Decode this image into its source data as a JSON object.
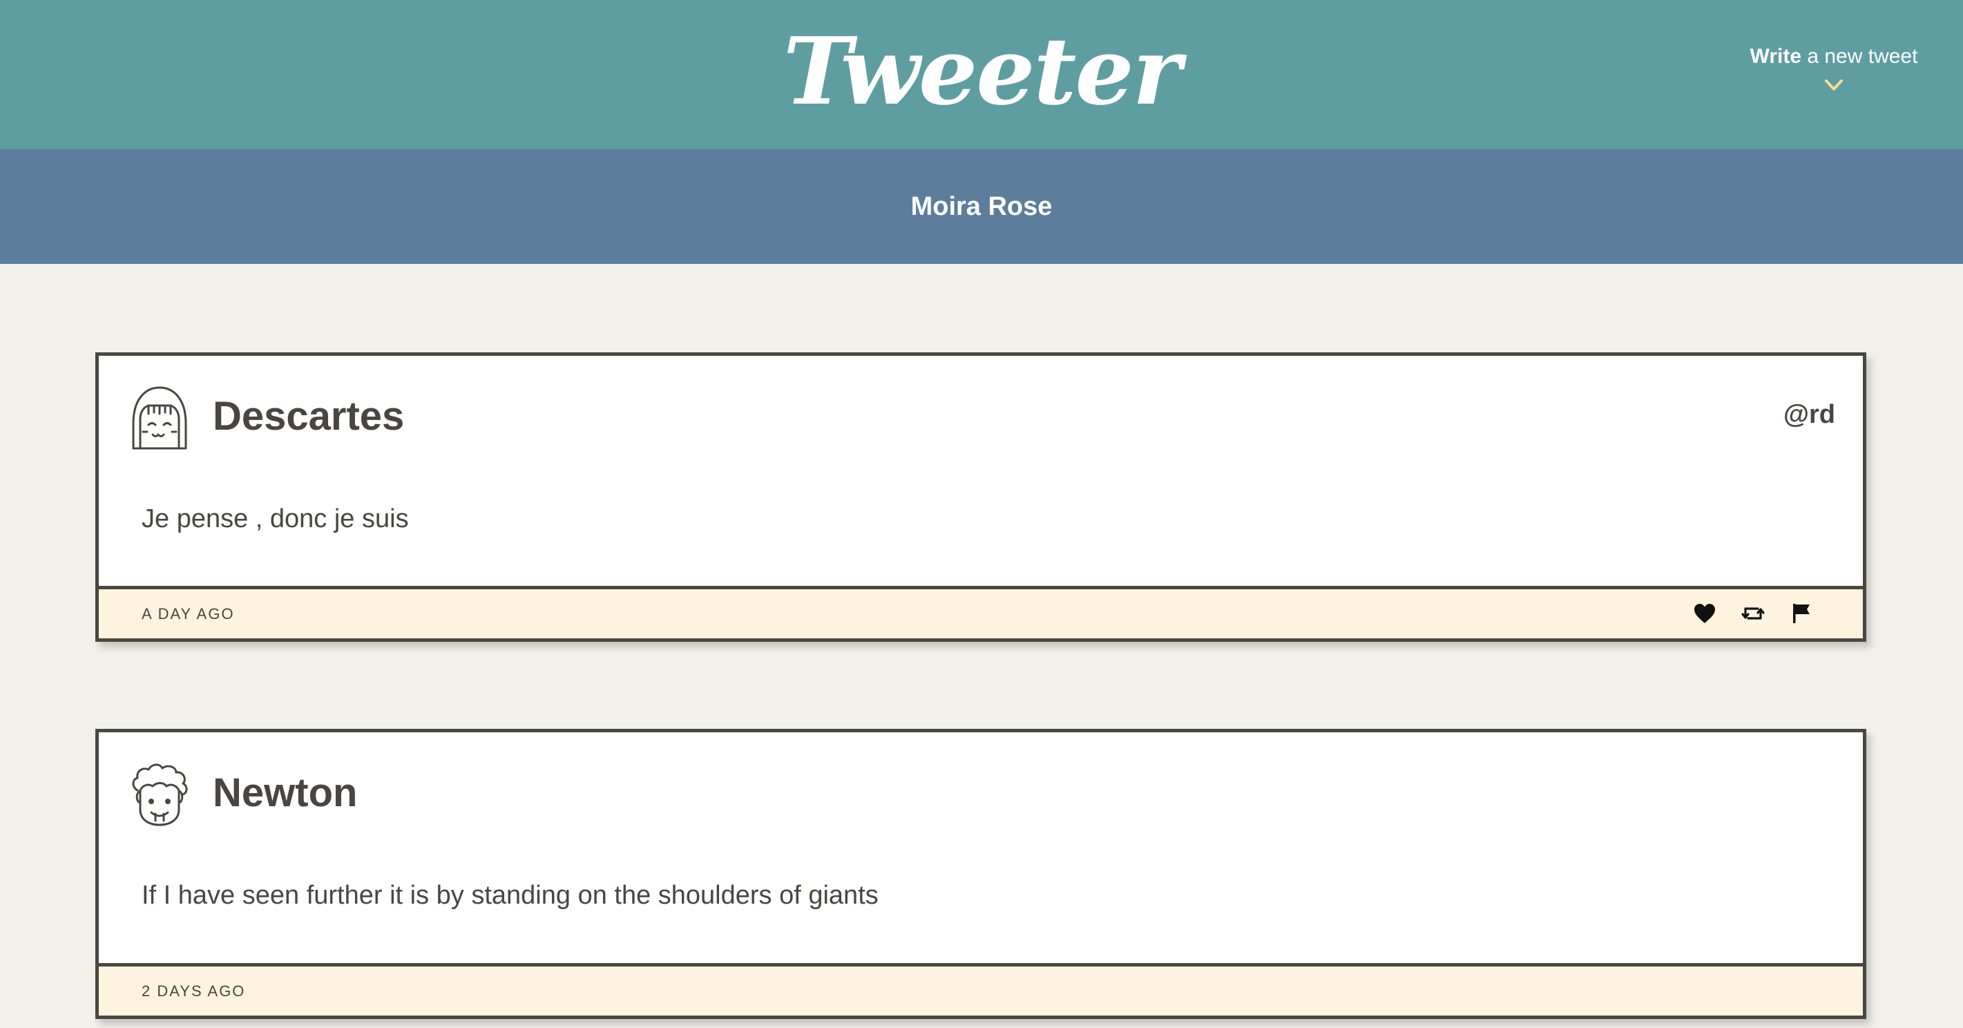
{
  "nav": {
    "logo": "Tweeter",
    "compose_strong": "Write",
    "compose_rest": " a new tweet",
    "chevron_color": "#f2e08a"
  },
  "profile": {
    "name": "Moira Rose"
  },
  "tweets": [
    {
      "author": "Descartes",
      "handle": "@rd",
      "content": "Je pense , donc je suis",
      "timestamp": "A DAY AGO",
      "avatar_icon": "girl-face-icon",
      "actions": [
        "heart-icon",
        "retweet-icon",
        "flag-icon"
      ]
    },
    {
      "author": "Newton",
      "handle": "",
      "content": "If I have seen further it is by standing on the shoulders of giants",
      "timestamp": "2 DAYS AGO",
      "avatar_icon": "curly-hair-face-icon",
      "actions": []
    }
  ],
  "colors": {
    "nav_bg": "#5f9ea0",
    "profile_bg": "#5d7d9d",
    "page_bg": "#f2f0eb",
    "footer_bg": "#fdf3df",
    "border": "#4a4741",
    "text": "#4a463f"
  }
}
